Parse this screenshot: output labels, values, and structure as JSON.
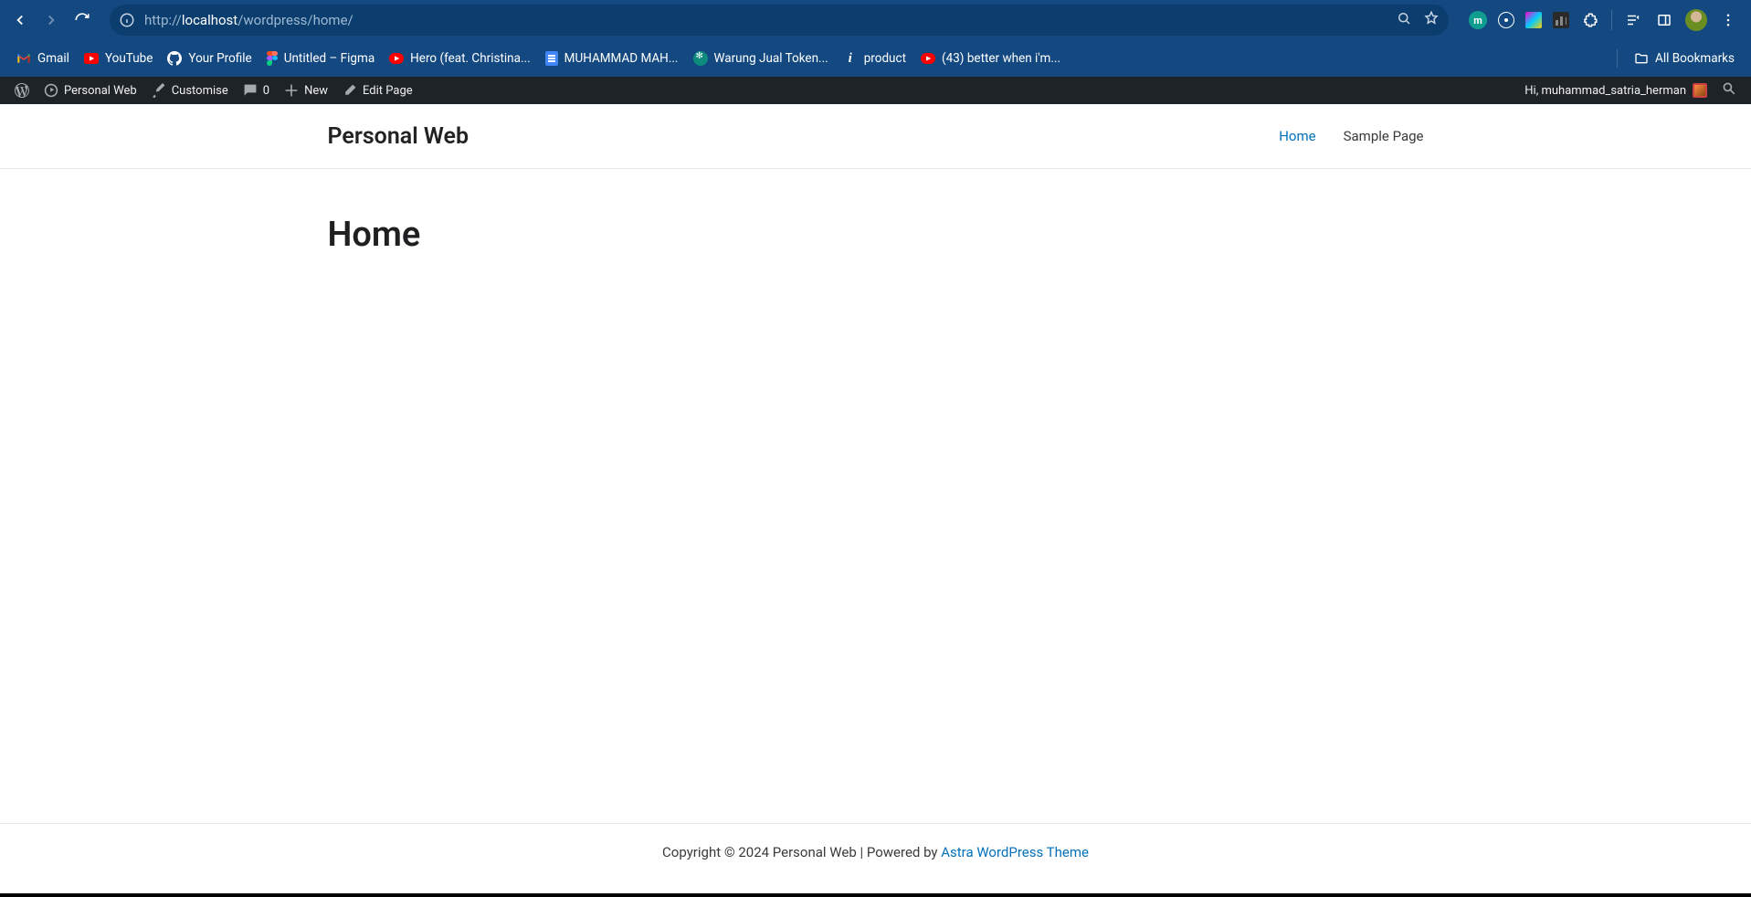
{
  "browser": {
    "url_prefix": "http://",
    "url_host": "localhost",
    "url_path": "/wordpress/home/"
  },
  "bookmarks": {
    "items": [
      {
        "label": "Gmail"
      },
      {
        "label": "YouTube"
      },
      {
        "label": "Your Profile"
      },
      {
        "label": "Untitled – Figma"
      },
      {
        "label": "Hero (feat. Christina..."
      },
      {
        "label": "MUHAMMAD MAH..."
      },
      {
        "label": "Warung Jual Token..."
      },
      {
        "label": "product"
      },
      {
        "label": "(43) better when i'm..."
      }
    ],
    "all": "All Bookmarks"
  },
  "wp": {
    "site_name": "Personal Web",
    "customise": "Customise",
    "comments_count": "0",
    "new": "New",
    "edit_page": "Edit Page",
    "greeting": "Hi, muhammad_satria_herman"
  },
  "site": {
    "title": "Personal Web",
    "nav": {
      "home": "Home",
      "sample": "Sample Page"
    },
    "page_heading": "Home",
    "footer_text": "Copyright © 2024 Personal Web | Powered by ",
    "footer_link": "Astra WordPress Theme"
  }
}
